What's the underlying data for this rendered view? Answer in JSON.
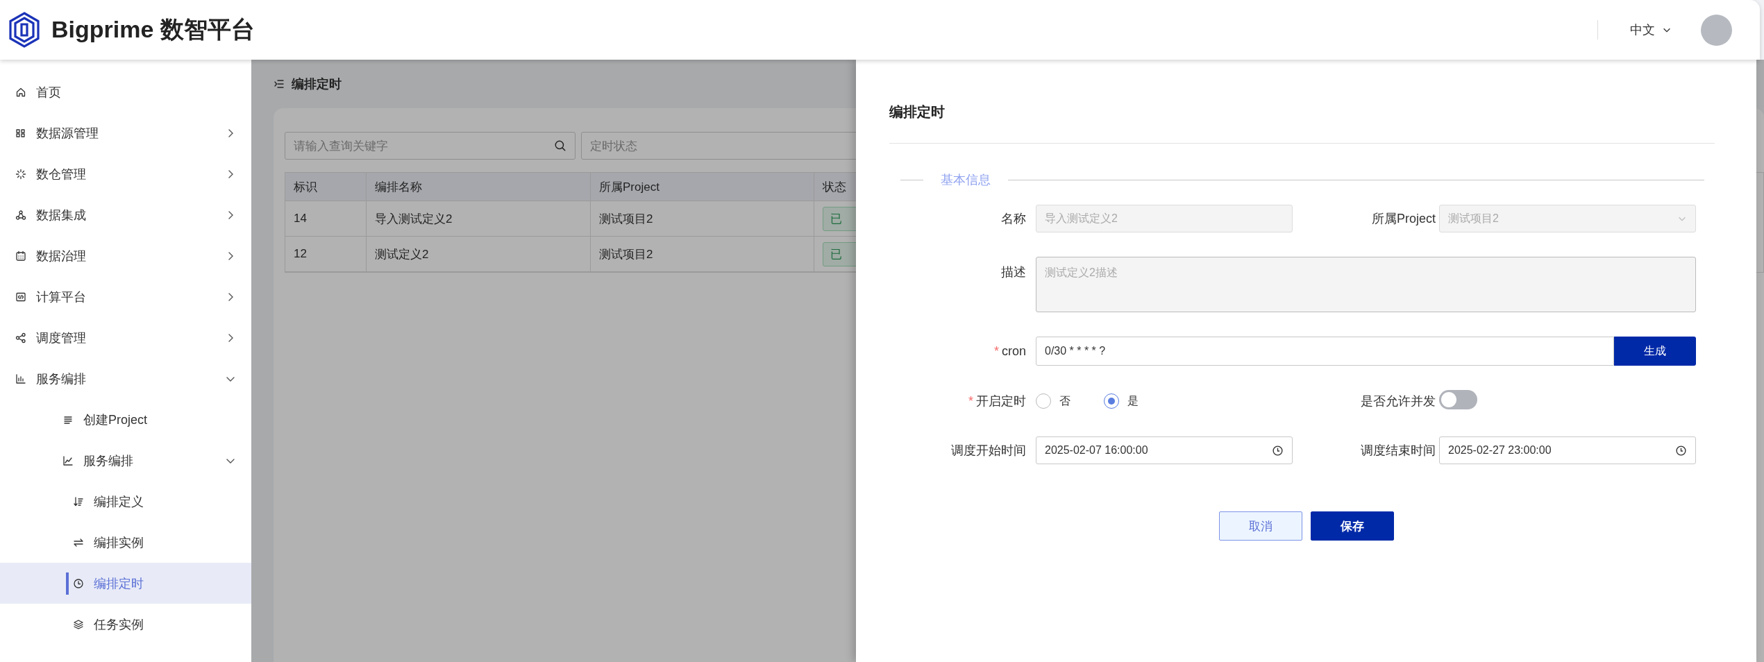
{
  "header": {
    "brand": "Bigprime 数智平台",
    "language": "中文"
  },
  "sidebar": {
    "items": [
      {
        "label": "首页",
        "kind": "link",
        "selected": false
      },
      {
        "label": "数据源管理",
        "kind": "group",
        "expanded": false,
        "selected": false
      },
      {
        "label": "数仓管理",
        "kind": "group",
        "expanded": false,
        "selected": false
      },
      {
        "label": "数据集成",
        "kind": "group",
        "expanded": false,
        "selected": false
      },
      {
        "label": "数据治理",
        "kind": "group",
        "expanded": false,
        "selected": false
      },
      {
        "label": "计算平台",
        "kind": "group",
        "expanded": false,
        "selected": false
      },
      {
        "label": "调度管理",
        "kind": "group",
        "expanded": false,
        "selected": false
      },
      {
        "label": "服务编排",
        "kind": "group",
        "expanded": true,
        "selected": false,
        "children": [
          {
            "label": "创建Project",
            "kind": "link",
            "selected": false
          },
          {
            "label": "服务编排",
            "kind": "group",
            "expanded": true,
            "selected": false,
            "children": [
              {
                "label": "编排定义",
                "kind": "link",
                "selected": false
              },
              {
                "label": "编排实例",
                "kind": "link",
                "selected": false
              },
              {
                "label": "编排定时",
                "kind": "link",
                "selected": true
              },
              {
                "label": "任务实例",
                "kind": "link",
                "selected": false
              }
            ]
          }
        ]
      }
    ]
  },
  "page": {
    "title": "编排定时",
    "search": {
      "placeholder": "请输入查询关键字"
    },
    "status_filter": {
      "placeholder": "定时状态"
    },
    "table": {
      "columns": [
        "标识",
        "编排名称",
        "所属Project",
        "状态"
      ],
      "rows": [
        [
          "14",
          "导入测试定义2",
          "测试项目2",
          "已"
        ],
        [
          "12",
          "测试定义2",
          "测试项目2",
          "已"
        ]
      ]
    }
  },
  "drawer": {
    "title": "编排定时",
    "section": "基本信息",
    "name": {
      "label": "名称",
      "value": "导入测试定义2",
      "disabled": true
    },
    "project": {
      "label": "所属Project",
      "value": "测试项目2",
      "disabled": true
    },
    "description": {
      "label": "描述",
      "value": "测试定义2描述",
      "disabled": true
    },
    "cron": {
      "label": "cron",
      "required_mark": "*",
      "value": "0/30 * * * * ?",
      "button": "生成"
    },
    "schedule_enabled": {
      "label": "开启定时",
      "required_mark": "*",
      "options": [
        {
          "label": "否",
          "selected": false
        },
        {
          "label": "是",
          "selected": true
        }
      ]
    },
    "allow_concurrent": {
      "label": "是否允许并发",
      "on": false
    },
    "start_time": {
      "label": "调度开始时间",
      "value": "2025-02-07 16:00:00"
    },
    "end_time": {
      "label": "调度结束时间",
      "value": "2025-02-27 23:00:00"
    },
    "buttons": [
      {
        "label": "取消",
        "kind": "secondary"
      },
      {
        "label": "保存",
        "kind": "primary"
      }
    ]
  }
}
